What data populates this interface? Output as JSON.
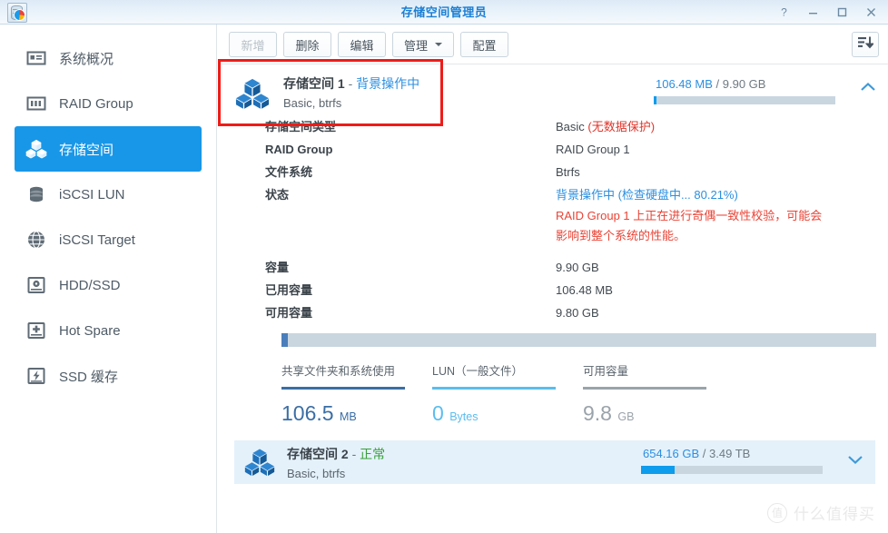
{
  "window": {
    "title": "存储空间管理员",
    "logo_icon": "storage-manager-app-icon",
    "controls": [
      {
        "name": "help-button",
        "icon": "question-mark-icon",
        "glyph": "?"
      },
      {
        "name": "minimize-button",
        "icon": "minimize-icon",
        "glyph": "—"
      },
      {
        "name": "maximize-button",
        "icon": "maximize-icon",
        "glyph": "☐"
      },
      {
        "name": "close-button",
        "icon": "close-icon",
        "glyph": "✕"
      }
    ]
  },
  "sidebar": {
    "items": [
      {
        "label": "系统概况",
        "icon": "overview-card-icon",
        "active": false
      },
      {
        "label": "RAID Group",
        "icon": "raid-group-icon",
        "active": false
      },
      {
        "label": "存储空间",
        "icon": "storage-volume-icon",
        "active": true
      },
      {
        "label": "iSCSI LUN",
        "icon": "iscsi-lun-icon",
        "active": false
      },
      {
        "label": "iSCSI Target",
        "icon": "iscsi-target-globe-icon",
        "active": false
      },
      {
        "label": "HDD/SSD",
        "icon": "hdd-ssd-icon",
        "active": false
      },
      {
        "label": "Hot Spare",
        "icon": "hot-spare-icon",
        "active": false
      },
      {
        "label": "SSD 缓存",
        "icon": "ssd-cache-icon",
        "active": false
      }
    ]
  },
  "toolbar": {
    "buttons": [
      {
        "label": "新增",
        "name": "create-button",
        "disabled": true,
        "caret": false
      },
      {
        "label": "删除",
        "name": "delete-button",
        "disabled": false,
        "caret": false
      },
      {
        "label": "编辑",
        "name": "edit-button",
        "disabled": false,
        "caret": false
      },
      {
        "label": "管理",
        "name": "manage-button",
        "disabled": false,
        "caret": true
      },
      {
        "label": "配置",
        "name": "configure-button",
        "disabled": false,
        "caret": false
      }
    ],
    "sort_icon": "sort-descending-icon"
  },
  "volume1": {
    "icon": "storage-volume-icon",
    "name": "存储空间 1",
    "separator": "-",
    "status": "背景操作中",
    "subtitle": "Basic, btrfs",
    "capacity_used": "106.48 MB",
    "capacity_slash": "/",
    "capacity_total": "9.90 GB",
    "bar_percent": 1.05,
    "collapse_icon": "chevron-up-icon",
    "rows": [
      {
        "label": "存储空间类型",
        "value": "Basic ",
        "value_red": "(无数据保护)",
        "blue": false
      },
      {
        "label": "RAID Group",
        "value": "RAID Group 1",
        "value_red": "",
        "blue": false
      },
      {
        "label": "文件系统",
        "value": "Btrfs",
        "value_red": "",
        "blue": false
      },
      {
        "label": "状态",
        "value": "背景操作中 (检查硬盘中... 80.21%)",
        "value_red": "",
        "blue": true
      }
    ],
    "warning": "RAID Group 1 上正在进行奇偶一致性校验，可能会影响到整个系统的性能。",
    "capacity_rows": [
      {
        "label": "容量",
        "value": "9.90 GB"
      },
      {
        "label": "已用容量",
        "value": "106.48 MB"
      },
      {
        "label": "可用容量",
        "value": "9.80 GB"
      }
    ],
    "usage_bar_percent": 1.05,
    "legend": [
      {
        "title": "共享文件夹和系统使用",
        "number": "106.5",
        "unit": "MB",
        "color": "#3b6ea5"
      },
      {
        "title": "LUN（一般文件）",
        "number": "0",
        "unit": "Bytes",
        "color": "#5bbdee"
      },
      {
        "title": "可用容量",
        "number": "9.8",
        "unit": "GB",
        "color": "#9aa3aa"
      }
    ]
  },
  "volume2": {
    "icon": "storage-volume-icon",
    "name": "存储空间 2",
    "separator": "-",
    "status": "正常",
    "subtitle": "Basic, btrfs",
    "capacity_used": "654.16 GB",
    "capacity_slash": "/",
    "capacity_total": "3.49 TB",
    "bar_percent": 18.3,
    "expand_icon": "chevron-down-icon"
  },
  "watermark": {
    "badge": "值",
    "text": "什么值得买"
  },
  "annotation": {
    "name": "red-highlight-box",
    "color": "#ee1c18"
  },
  "colors": {
    "accent_blue": "#1897e8",
    "link_blue": "#2b8fe0",
    "status_green": "#3aa03a",
    "warning_red": "#ea4335",
    "bar_track": "#c9d6e0",
    "bar_fill": "#0e9ced",
    "vol2_bg": "#e4f1fb"
  }
}
